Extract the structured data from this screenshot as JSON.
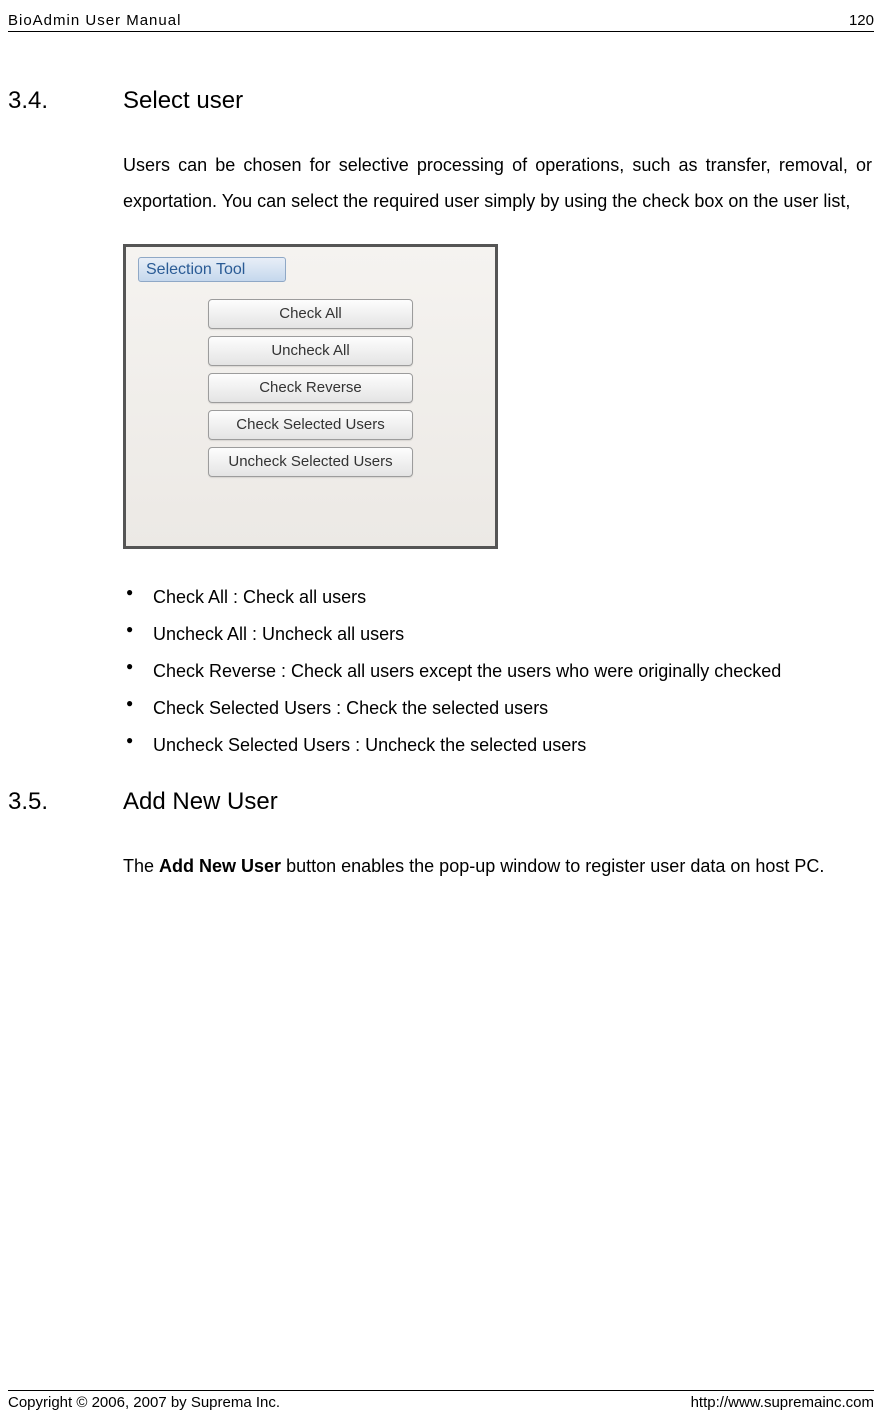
{
  "header": {
    "left": "BioAdmin User Manual",
    "right": "120"
  },
  "sections": [
    {
      "num": "3.4.",
      "title": "Select user",
      "para": "Users can be chosen for selective processing of operations, such as transfer, removal, or exportation. You can select the required user simply by using the check box on the user list,",
      "panel": {
        "title": "Selection Tool",
        "buttons": [
          "Check All",
          "Uncheck All",
          "Check Reverse",
          "Check Selected Users",
          "Uncheck Selected Users"
        ]
      },
      "bullets": [
        "Check All : Check all users",
        "Uncheck All : Uncheck all users",
        "Check Reverse : Check all users except the users who were originally checked",
        "Check Selected Users : Check the selected users",
        "Uncheck Selected Users : Uncheck the selected users"
      ]
    },
    {
      "num": "3.5.",
      "title": "Add New User",
      "para_pre": "The ",
      "para_bold": "Add New User",
      "para_post": " button enables the pop-up window to register user data on host PC."
    }
  ],
  "footer": {
    "left": "Copyright © 2006, 2007 by Suprema Inc.",
    "right": "http://www.supremainc.com"
  }
}
